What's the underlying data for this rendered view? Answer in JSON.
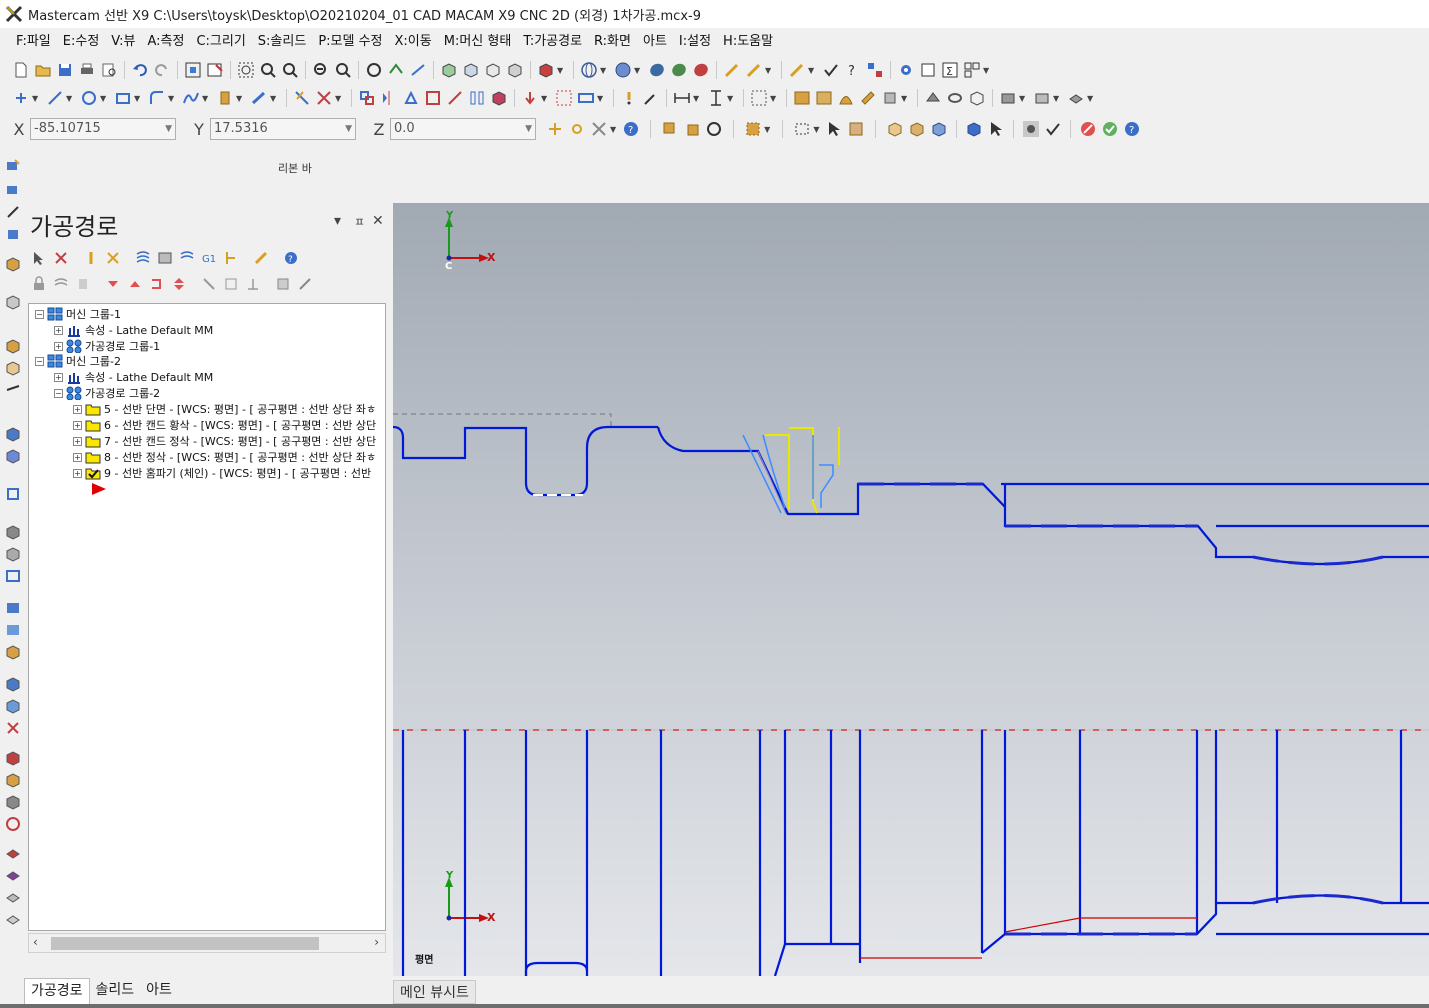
{
  "window": {
    "title": "Mastercam 선반 X9  C:\\Users\\toysk\\Desktop\\O20210204_01 CAD MACAM X9 CNC 2D (외경) 1차가공.mcx-9"
  },
  "menu": [
    {
      "label": "F:파일"
    },
    {
      "label": "E:수정"
    },
    {
      "label": "V:뷰"
    },
    {
      "label": "A:측정"
    },
    {
      "label": "C:그리기"
    },
    {
      "label": "S:솔리드"
    },
    {
      "label": "P:모델 수정"
    },
    {
      "label": "X:이동"
    },
    {
      "label": "M:머신 형태"
    },
    {
      "label": "T:가공경로"
    },
    {
      "label": "R:화면"
    },
    {
      "label": "아트"
    },
    {
      "label": "I:설정"
    },
    {
      "label": "H:도움말"
    }
  ],
  "coords": {
    "x_label": "X",
    "x_value": "-85.10715",
    "y_label": "Y",
    "y_value": "17.5316",
    "z_label": "Z",
    "z_value": "0.0"
  },
  "ribbon_label": "리본 바",
  "manager": {
    "title": "가공경로",
    "pin": "ㅍ",
    "close": "✕",
    "collapse": "▾",
    "tree": [
      {
        "label": "머신 그룹-1"
      },
      {
        "label": "속성 - Lathe Default MM"
      },
      {
        "label": "가공경로 그룹-1"
      },
      {
        "label": "머신 그룹-2"
      },
      {
        "label": "속성 - Lathe Default MM"
      },
      {
        "label": "가공경로 그룹-2"
      },
      {
        "label": "5 - 선반 단면 - [WCS: 평면] - [  공구평면  : 선반 상단 좌ㅎ"
      },
      {
        "label": "6 - 선반 캔드 황삭 - [WCS: 평면] - [  공구평면  : 선반 상단"
      },
      {
        "label": "7 - 선반 캔드 정삭 - [WCS: 평면] - [  공구평면  : 선반 상단"
      },
      {
        "label": "8 - 선반 정삭 - [WCS: 평면] - [  공구평면  : 선반 상단 좌ㅎ"
      },
      {
        "label": "9 - 선반 홈파기 (체인) - [WCS: 평면] - [  공구평면  : 선반"
      }
    ],
    "tabs": [
      {
        "label": "가공경로"
      },
      {
        "label": "솔리드"
      },
      {
        "label": "아트"
      }
    ]
  },
  "view": {
    "axis_top": {
      "y": "Y",
      "x": "X",
      "c": "C"
    },
    "axis_bottom": {
      "y": "Y",
      "x": "X"
    },
    "view_name": "평면",
    "tabs": [
      {
        "label": "메인 뷰시트"
      }
    ]
  },
  "colors": {
    "geometry": "#0018d8",
    "toolpath_red": "#e00000",
    "tool_yellow": "#e8e800",
    "tool_light_blue": "#3c8cff",
    "background_top": "#a1a9b3",
    "background_bottom": "#e4e6ea"
  }
}
